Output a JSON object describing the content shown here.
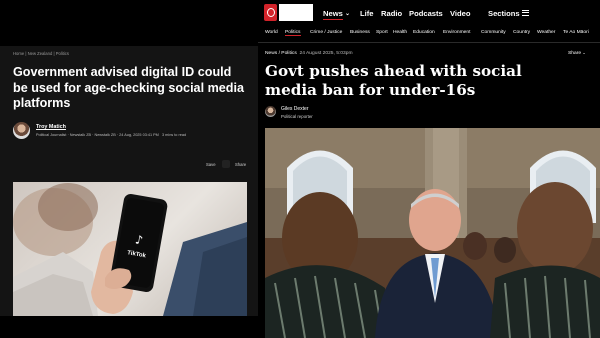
{
  "left": {
    "breadcrumb": [
      "Home",
      "New Zealand",
      "Politics"
    ],
    "breadcrumb_separator": " | ",
    "headline": "Government advised digital ID could be used for age-checking social media platforms",
    "author": "Troy Matich",
    "author_meta": "Political Journalist · Newstalk ZB · Newstalk ZB",
    "timestamp": "· 24 Aug, 2025 03:41 PM",
    "read_time": "3 mins to read",
    "actions": {
      "save": "Save",
      "share": "Share"
    },
    "photo": {
      "app_label": "TikTok"
    }
  },
  "right": {
    "nav": {
      "items": [
        "News",
        "Life",
        "Radio",
        "Podcasts",
        "Video"
      ],
      "active": "News",
      "sections": "Sections"
    },
    "subnav": {
      "items": [
        "World",
        "Politics",
        "Crime / Justice",
        "Business",
        "Sport",
        "Health",
        "Education",
        "Environment",
        "Community",
        "Country",
        "Weather",
        "Te Ao Māori"
      ],
      "active": "Politics"
    },
    "breadcrumb": "News / Politics",
    "date": "24 August 2025, 5:03pm",
    "share": "Share",
    "headline": "Govt pushes ahead with social media ban for under-16s",
    "author": "Giles Dexter",
    "role": "Political reporter"
  },
  "colors": {
    "rnz_red": "#d2232a",
    "background": "#000000",
    "left_panel": "#141414"
  },
  "icons": [
    "rnz-logo-icon",
    "chevron-down-icon",
    "hamburger-icon",
    "share-icon"
  ]
}
